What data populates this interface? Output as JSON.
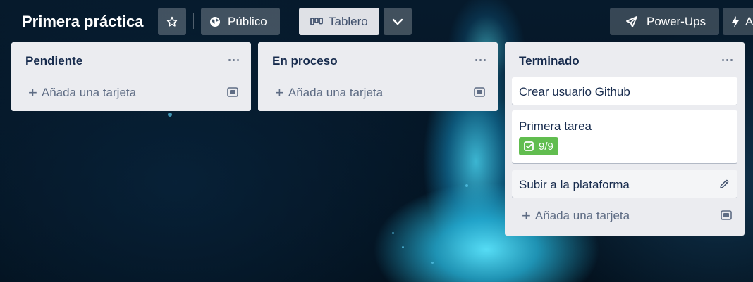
{
  "board": {
    "title": "Primera práctica",
    "visibility_label": "Público",
    "view_label": "Tablero",
    "powerups_label": "Power-Ups",
    "automation_label": "A"
  },
  "icons": {
    "star": "star-icon",
    "visibility": "globe-icon",
    "view": "board-icon",
    "dropdown": "chevron-down-icon",
    "powerups": "rocket-icon",
    "automation": "lightning-icon",
    "list_menu": "more-icon",
    "template": "card-template-icon",
    "checklist": "checklist-icon",
    "edit": "pencil-icon"
  },
  "colors": {
    "list_bg": "#ebecf0",
    "badge_green": "#61bd4f",
    "text_dark": "#172b4d",
    "text_muted": "#5e6c84"
  },
  "lists": [
    {
      "title": "Pendiente",
      "add_card_label": "Añada una tarjeta",
      "cards": []
    },
    {
      "title": "En proceso",
      "add_card_label": "Añada una tarjeta",
      "cards": []
    },
    {
      "title": "Terminado",
      "add_card_label": "Añada una tarjeta",
      "cards": [
        {
          "title": "Crear usuario Github"
        },
        {
          "title": "Primera tarea",
          "checklist_badge": "9/9"
        },
        {
          "title": "Subir a la plataforma"
        }
      ]
    }
  ]
}
